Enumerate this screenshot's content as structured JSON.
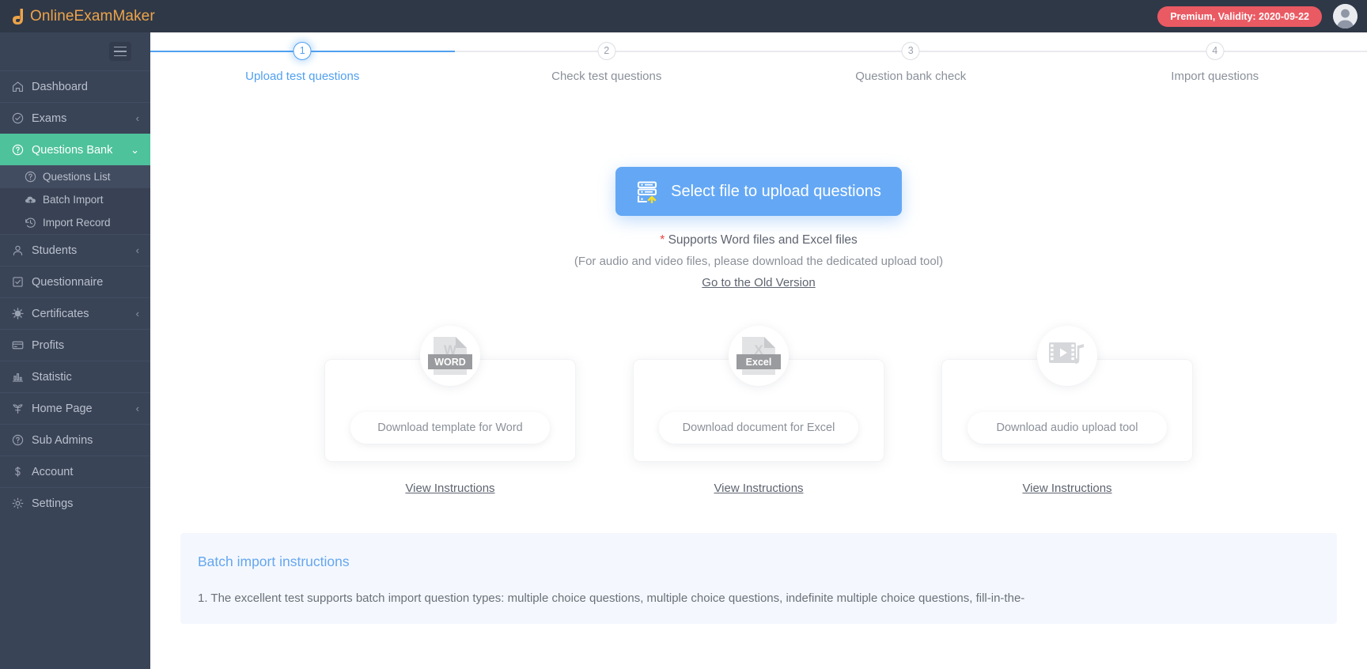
{
  "topbar": {
    "brand": "OnlineExamMaker",
    "premium_badge": "Premium, Validity: 2020-09-22",
    "avatar_icon": "user-avatar-icon",
    "brand_color": "#eda44a",
    "badge_color": "#ea5a63"
  },
  "sidebar": {
    "hamburger_icon": "hamburger-menu-icon",
    "items": [
      {
        "label": "Dashboard",
        "icon": "home-icon",
        "chevron": "",
        "active": false
      },
      {
        "label": "Exams",
        "icon": "check-circle-icon",
        "chevron": "‹",
        "active": false
      },
      {
        "label": "Questions Bank",
        "icon": "question-circle-icon",
        "chevron": "⌄",
        "active": true
      },
      {
        "label": "Students",
        "icon": "users-icon",
        "chevron": "‹",
        "active": false
      },
      {
        "label": "Questionnaire",
        "icon": "checkbox-icon",
        "chevron": "",
        "active": false
      },
      {
        "label": "Certificates",
        "icon": "badge-icon",
        "chevron": "‹",
        "active": false
      },
      {
        "label": "Profits",
        "icon": "card-icon",
        "chevron": "",
        "active": false
      },
      {
        "label": "Statistic",
        "icon": "bar-chart-icon",
        "chevron": "",
        "active": false
      },
      {
        "label": "Home Page",
        "icon": "leaf-icon",
        "chevron": "‹",
        "active": false
      },
      {
        "label": "Sub Admins",
        "icon": "question-circle-icon",
        "chevron": "",
        "active": false
      },
      {
        "label": "Account",
        "icon": "dollar-icon",
        "chevron": "",
        "active": false
      },
      {
        "label": "Settings",
        "icon": "gear-icon",
        "chevron": "",
        "active": false
      }
    ],
    "subitems": [
      {
        "label": "Questions List",
        "icon": "question-circle-icon",
        "selected": true
      },
      {
        "label": "Batch Import",
        "icon": "cloud-upload-icon",
        "selected": false
      },
      {
        "label": "Import Record",
        "icon": "history-icon",
        "selected": false
      }
    ],
    "active_color": "#4ec29b"
  },
  "steps": [
    {
      "num": "1",
      "label": "Upload test questions",
      "state": "current"
    },
    {
      "num": "2",
      "label": "Check test questions",
      "state": "pending"
    },
    {
      "num": "3",
      "label": "Question bank check",
      "state": "pending"
    },
    {
      "num": "4",
      "label": "Import questions",
      "state": "pending"
    }
  ],
  "upload": {
    "button_label": "Select file to upload questions",
    "button_icon": "server-upload-icon",
    "button_color": "#64a8f5",
    "note_star": "*",
    "note_line1": "Supports Word files and Excel files",
    "note_line2": "(For audio and video files, please download the dedicated upload tool)",
    "old_version_link": "Go to the Old Version"
  },
  "cards": [
    {
      "icon": "word-file-icon",
      "icon_big": "W",
      "icon_band": "WORD",
      "download_label": "Download template for Word",
      "view_label": "View Instructions"
    },
    {
      "icon": "excel-file-icon",
      "icon_big": "X",
      "icon_band": "Excel",
      "download_label": "Download document for Excel",
      "view_label": "View Instructions"
    },
    {
      "icon": "film-music-icon",
      "icon_big": "",
      "icon_band": "",
      "download_label": "Download audio upload tool",
      "view_label": "View Instructions"
    }
  ],
  "batch": {
    "title": "Batch import instructions",
    "line1": "1. The excellent test supports batch import question types: multiple choice questions, multiple choice questions, indefinite multiple choice questions, fill-in-the-"
  }
}
